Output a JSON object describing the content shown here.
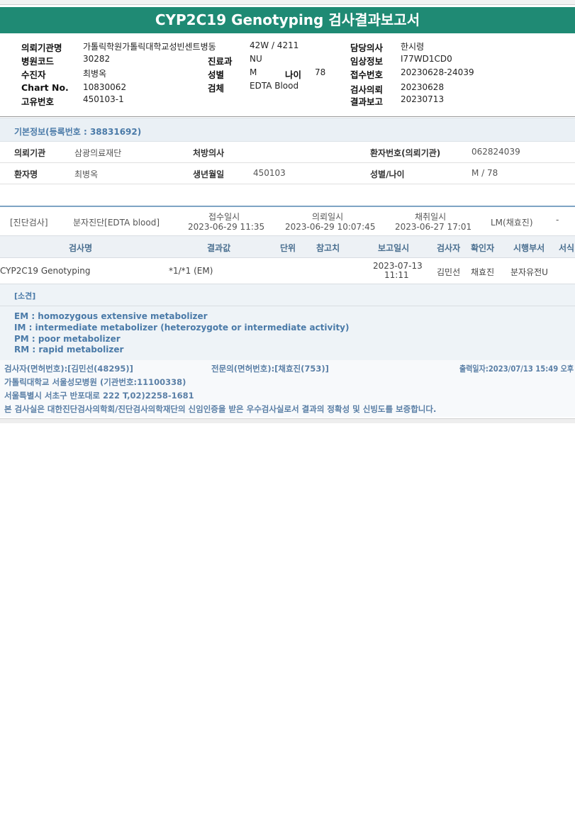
{
  "title": "CYP2C19 Genotyping 검사결과보고서",
  "header": {
    "inst_label": "의뢰기관명",
    "inst_value": "가톨릭학원가톨릭대학교성빈센트병동",
    "ward_value": "42W / 4211",
    "doctor_label": "담당의사",
    "doctor_value": "한시령",
    "hospcode_label": "병원코드",
    "hospcode_value": "30282",
    "dept_label": "진료과",
    "dept_value": "NU",
    "clinical_label": "임상정보",
    "clinical_value": "I77WD1CD0",
    "patient_label": "수진자",
    "patient_value": "최병옥",
    "sex_label": "성별",
    "sex_value": "M",
    "age_label": "나이",
    "age_value": "78",
    "receipt_label": "접수번호",
    "receipt_value": "20230628-24039",
    "chart_label": "Chart No.",
    "chart_value": "10830062",
    "specimen_label": "검체",
    "specimen_value": "EDTA Blood",
    "request_label": "검사의뢰",
    "request_value": "20230628",
    "unique_label": "고유번호",
    "unique_value": "450103-1",
    "report_label": "결과보고",
    "report_value": "20230713"
  },
  "basic": {
    "title": "기본정보(등록번호 : 38831692)",
    "inst_label": "의뢰기관",
    "inst_value": "삼광의료재단",
    "presc_label": "처방의사",
    "presc_value": "",
    "pnum_label": "환자번호(의뢰기관)",
    "pnum_value": "062824039",
    "name_label": "환자명",
    "name_value": "최병옥",
    "dob_label": "생년월일",
    "dob_value": "450103",
    "sexage_label": "성별/나이",
    "sexage_value": "M / 78"
  },
  "order": {
    "category": "[진단검사]",
    "dept": "분자진단[EDTA blood]",
    "recv_label": "접수일시",
    "recv_value": "2023-06-29 11:35",
    "req_label": "의뢰일시",
    "req_value": "2023-06-29 10:07:45",
    "coll_label": "채취일시",
    "coll_value": "2023-06-27 17:01",
    "collector": "LM(채효진)",
    "dash": "-"
  },
  "table": {
    "headers": [
      "검사명",
      "결과값",
      "단위",
      "참고치",
      "보고일시",
      "검사자",
      "확인자",
      "시행부서",
      "서식"
    ],
    "row": {
      "test": "CYP2C19 Genotyping",
      "result": "*1/*1 (EM)",
      "unit": "",
      "ref": "",
      "report_date": "2023-07-13",
      "report_time": "11:11",
      "tester": "김민선",
      "verifier": "채효진",
      "dept": "분자유전U",
      "form": ""
    }
  },
  "opinion": {
    "title": "[소견]",
    "lines": [
      "EM : homozygous extensive metabolizer",
      "IM  : intermediate metabolizer (heterozygote or intermediate activity)",
      "PM : poor metabolizer",
      "RM : rapid metabolizer"
    ]
  },
  "footer": {
    "tester": "검사자(면허번호):[김민선(48295)]",
    "specialist": "전문의(면허번호):[채효진(753)]",
    "printed": "출력일자:2023/07/13 15:49 오후",
    "hospital": "가톨릭대학교 서울성모병원 (기관번호:11100338)",
    "address": "서울특별시 서초구 반포대로 222 T,02)2258-1681",
    "certification": "본 검사실은 대한진단검사의학회/진단검사의학재단의 신임인증을 받은 우수검사실로서 결과의 정확성 및 신빙도를 보증합니다."
  },
  "colors": {
    "title_bar": "#1f8a74",
    "section_text": "#4a7aa8"
  }
}
